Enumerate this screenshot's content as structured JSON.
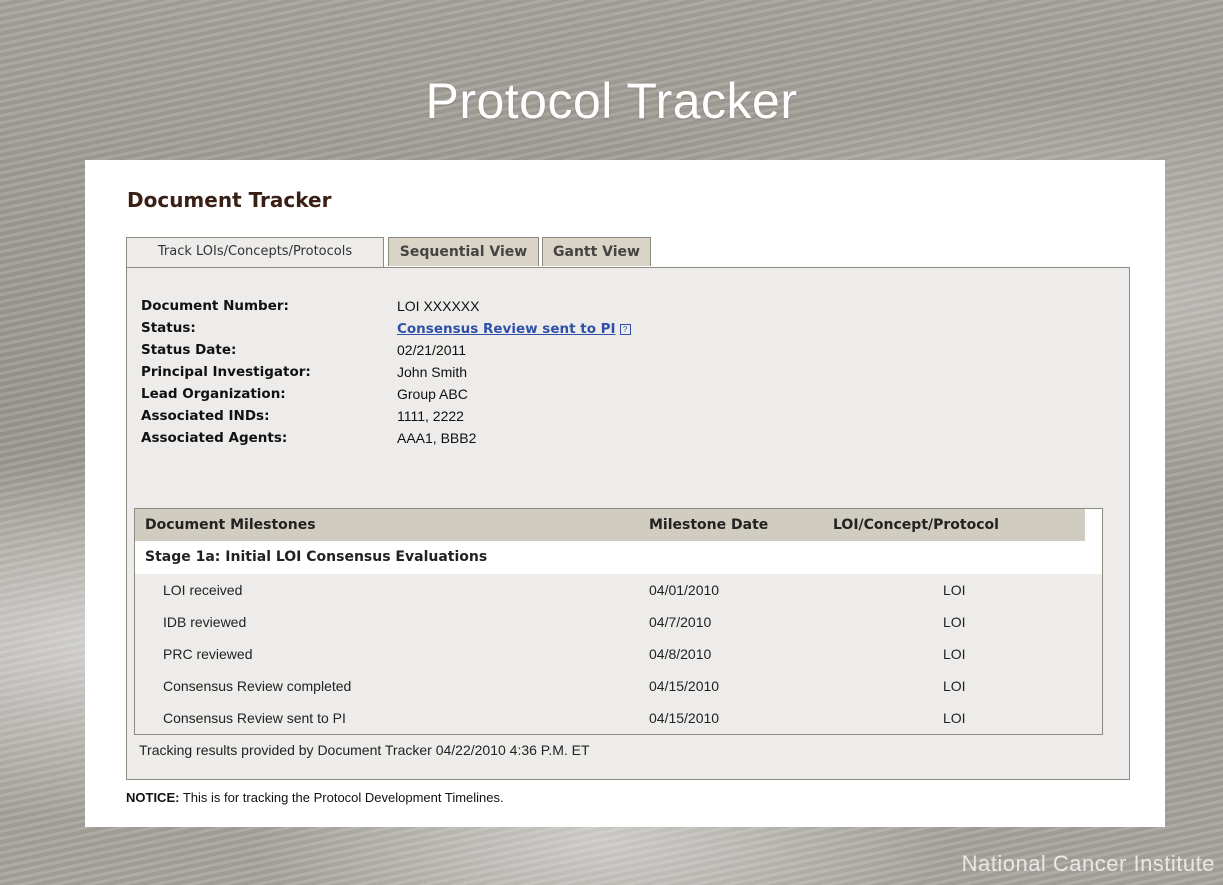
{
  "slide": {
    "title": "Protocol Tracker",
    "footer_brand": "National Cancer Institute"
  },
  "panel": {
    "title": "Document Tracker",
    "tabs": [
      {
        "label": "Track LOIs/Concepts/Protocols",
        "active": true
      },
      {
        "label": "Sequential View",
        "active": false
      },
      {
        "label": "Gantt View",
        "active": false
      }
    ],
    "info": [
      {
        "label": "Document Number:",
        "value": "LOI XXXXXX"
      },
      {
        "label": "Status:",
        "value": "Consensus Review sent to PI",
        "is_link": true,
        "icon": "help-icon"
      },
      {
        "label": "Status Date:",
        "value": "02/21/2011"
      },
      {
        "label": "Principal Investigator:",
        "value": "John Smith"
      },
      {
        "label": "Lead Organization:",
        "value": "Group ABC"
      },
      {
        "label": "Associated INDs:",
        "value": "1111, 2222"
      },
      {
        "label": "Associated Agents:",
        "value": "AAA1, BBB2"
      }
    ],
    "milestones": {
      "headers": [
        "Document Milestones",
        "Milestone Date",
        "LOI/Concept/Protocol"
      ],
      "stage": "Stage 1a: Initial LOI Consensus Evaluations",
      "rows": [
        {
          "name": "LOI received",
          "date": "04/01/2010",
          "type": "LOI"
        },
        {
          "name": "IDB reviewed",
          "date": "04/7/2010",
          "type": "LOI"
        },
        {
          "name": "PRC reviewed",
          "date": "04/8/2010",
          "type": "LOI"
        },
        {
          "name": "Consensus Review completed",
          "date": "04/15/2010",
          "type": "LOI"
        },
        {
          "name": "Consensus Review sent to PI",
          "date": "04/15/2010",
          "type": "LOI"
        }
      ]
    },
    "tracking_note": "Tracking results provided by Document Tracker 04/22/2010 4:36 P.M.  ET",
    "notice_label": "NOTICE:",
    "notice_text": " This is for tracking the Protocol Development Timelines."
  },
  "colors": {
    "title_text": "#3a1f15",
    "link": "#2f4fa8",
    "tab_bg": "#d9d4c6",
    "body_bg": "#edecea",
    "header_bg": "#d1ccc0"
  }
}
